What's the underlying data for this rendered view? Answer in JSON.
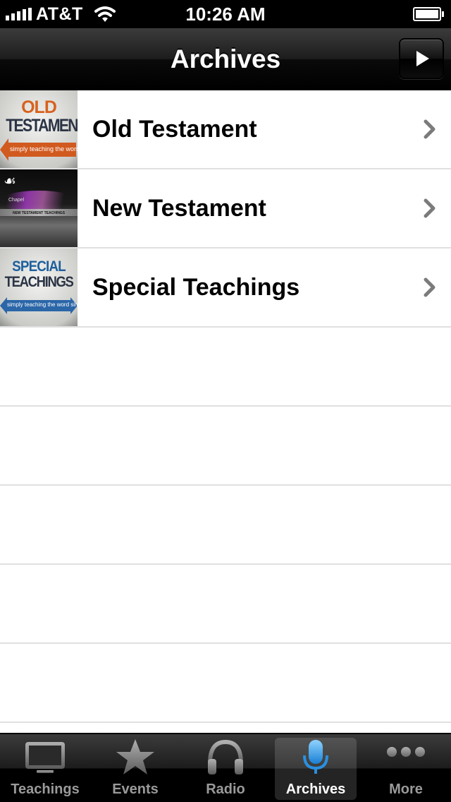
{
  "status_bar": {
    "carrier": "AT&T",
    "time": "10:26 AM",
    "signal_icon": "signal-bars-icon",
    "wifi_icon": "wifi-icon",
    "battery_icon": "battery-icon"
  },
  "nav_bar": {
    "title": "Archives",
    "play_icon": "play-icon"
  },
  "rows": [
    {
      "label": "Old Testament",
      "thumbnail": {
        "line1": "OLD",
        "line2": "TESTAMENT",
        "subtitle": "simply teaching the word simply"
      }
    },
    {
      "label": "New Testament",
      "thumbnail": {
        "caption": "NEW TESTAMENT TEACHINGS",
        "chapel": "Chapel"
      }
    },
    {
      "label": "Special Teachings",
      "thumbnail": {
        "line1": "SPECIAL",
        "line2": "TEACHINGS",
        "subtitle": "simply teaching the word simply"
      }
    }
  ],
  "tabs": [
    {
      "label": "Teachings",
      "icon": "tv-icon",
      "selected": false
    },
    {
      "label": "Events",
      "icon": "star-icon",
      "selected": false
    },
    {
      "label": "Radio",
      "icon": "headphones-icon",
      "selected": false
    },
    {
      "label": "Archives",
      "icon": "microphone-icon",
      "selected": true
    },
    {
      "label": "More",
      "icon": "more-dots-icon",
      "selected": false
    }
  ],
  "colors": {
    "selected_tab_icon": "#3a9ee8",
    "unselected_tab_icon": "#8c8c8c",
    "row_separator": "#e0e0e0",
    "chevron": "#7b7b7b"
  }
}
